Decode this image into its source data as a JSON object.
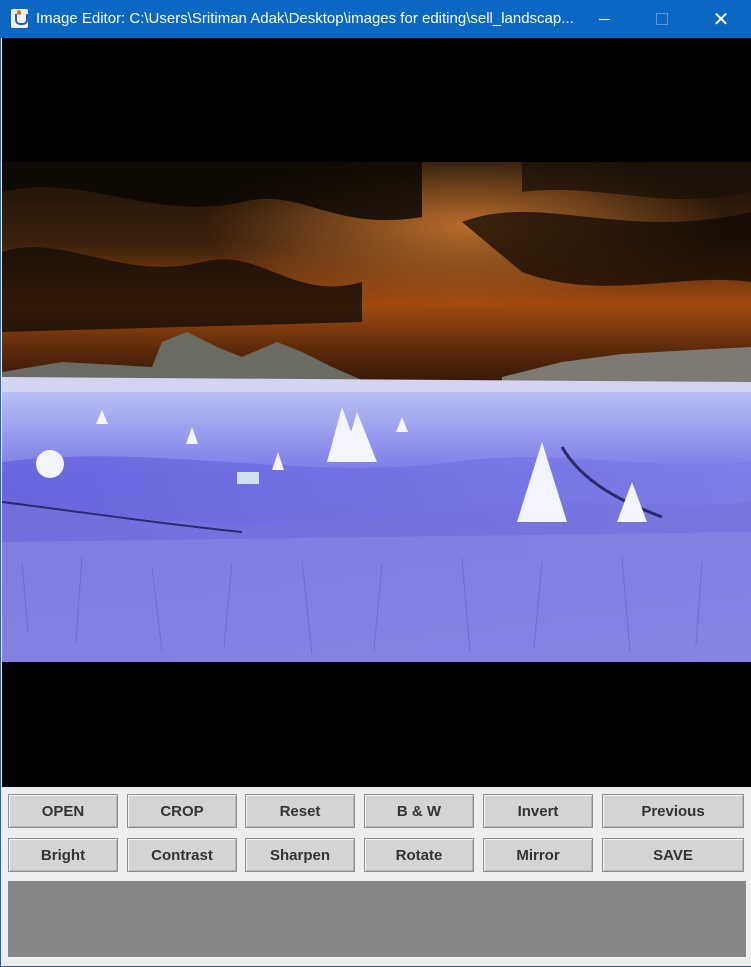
{
  "window": {
    "title": "Image Editor: C:\\Users\\Sritiman Adak\\Desktop\\images for editing\\sell_landscap..."
  },
  "toolbar": {
    "row1": [
      "OPEN",
      "CROP",
      "Reset",
      "B & W",
      "Invert",
      "Previous"
    ],
    "row2": [
      "Bright",
      "Contrast",
      "Sharpen",
      "Rotate",
      "Mirror",
      "SAVE"
    ]
  },
  "image": {
    "description_icon": "inverted-landscape-photo"
  },
  "colors": {
    "titlebar": "#0a67c2",
    "button_face": "#d4d4d4",
    "canvas_bg": "#000000",
    "status_area": "#868686"
  }
}
